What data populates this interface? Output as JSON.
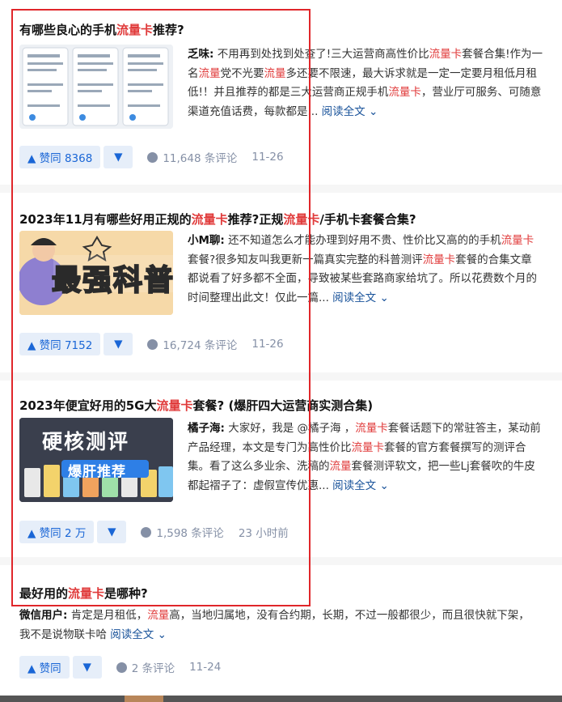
{
  "cards": [
    {
      "title_a": "有哪些良心的手机",
      "title_hl": "流量卡",
      "title_b": "推荐?",
      "author": "乏味:",
      "excerpt_segments": [
        "不用再到处找到处查了!三大运营商高性价比",
        "流量卡",
        "套餐合集!作为一名",
        "流量",
        "党不光要",
        "流量",
        "多还要不限速，最大诉求就是一定一定要月租低月租低!！并且推荐的都是三大运营商正规手机",
        "流量卡",
        "，营业厅可服务、可随意渠道充值话费，每款都是..."
      ],
      "read_more": "阅读全文",
      "upvote": "▲ 赞同 8368",
      "downvote": "▼",
      "comments": "11,648 条评论",
      "date": "11-26"
    },
    {
      "title_a": "2023年11月有哪些好用正规的",
      "title_hl": "流量卡",
      "title_b": "推荐?正规",
      "title_hl2": "流量卡",
      "title_c": "/手机卡套餐合集?",
      "author": "小M聊:",
      "thumb_text": "最强科普",
      "excerpt_segments": [
        "还不知道怎么才能办理到好用不贵、性价比又高的的手机",
        "流量卡",
        "套餐?很多知友叫我更新一篇真实完整的科普测评",
        "流量卡",
        "套餐的合集文章 都说看了好多都不全面，导致被某些套路商家给坑了。所以花费数个月的时间整理出此文！仅此一篇..."
      ],
      "read_more": "阅读全文",
      "upvote": "▲ 赞同 7152",
      "downvote": "▼",
      "comments": "16,724 条评论",
      "date": "11-26"
    },
    {
      "title_a": "2023年便宜好用的5G大",
      "title_hl": "流量卡",
      "title_b": "套餐? (爆肝四大运营商实测合集)",
      "author": "橘子海:",
      "thumb_text1": "硬核测评",
      "thumb_text2": "爆肝推荐",
      "excerpt_segments": [
        "大家好，我是 @橘子海 ，",
        "流量卡",
        "套餐话题下的常驻答主，某动前产品经理，本文是专门为高性价比",
        "流量卡",
        "套餐的官方套餐撰写的测评合集。看了这么多业余、洗稿的",
        "流量",
        "套餐测评软文，把一些Lj套餐吹的牛皮都起褶子了：虚假宣传优惠..."
      ],
      "read_more": "阅读全文",
      "upvote": "▲ 赞同 2 万",
      "downvote": "▼",
      "comments": "1,598 条评论",
      "date": "23 小时前"
    },
    {
      "title_a": "最好用的",
      "title_hl": "流量卡",
      "title_b": "是哪种?",
      "author": "微信用户:",
      "excerpt_segments": [
        "肯定是月租低，",
        "流量",
        "高，当地归属地，没有合约期，长期，不过一般都很少，而且很快就下架，我不是说物联卡哈"
      ],
      "read_more": "阅读全文",
      "upvote": "▲ 赞同",
      "downvote": "▼",
      "comments": "2 条评论",
      "date": "11-24"
    }
  ],
  "colors": {
    "highlight": "#e03a3a",
    "link": "#175199",
    "vote_bg": "#e6eef9",
    "vote_fg": "#1a66d6",
    "annotation_box": "#e0262a"
  }
}
